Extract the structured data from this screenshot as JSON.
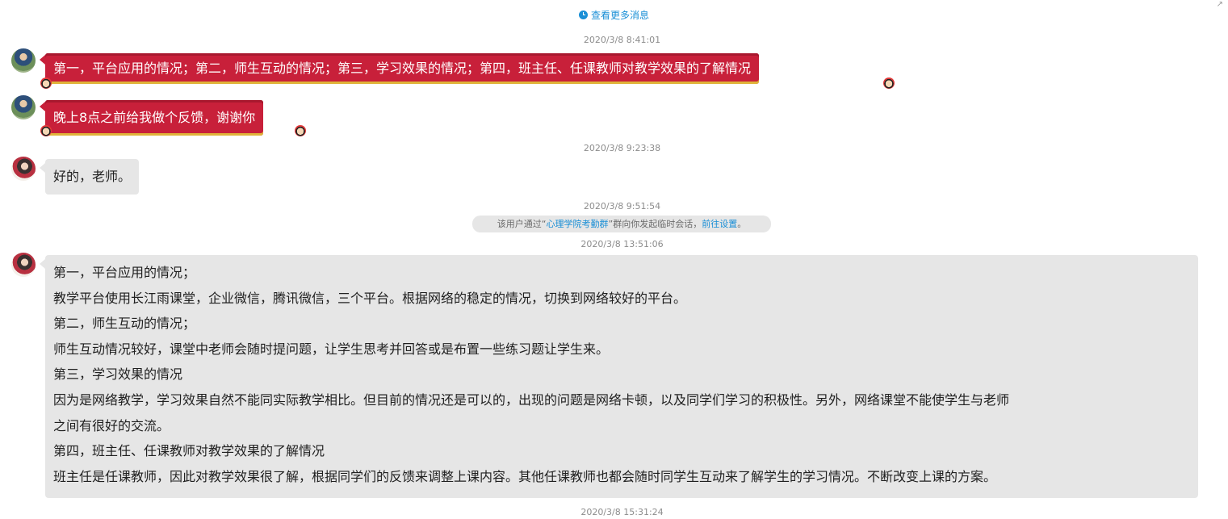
{
  "header": {
    "view_more_label": "查看更多消息"
  },
  "timestamps": {
    "t1": "2020/3/8 8:41:01",
    "t2": "2020/3/8 9:23:38",
    "t3": "2020/3/8 9:51:54",
    "t4": "2020/3/8 13:51:06",
    "t5": "2020/3/8 15:31:24"
  },
  "messages": {
    "m1": "第一，平台应用的情况；第二，师生互动的情况；第三，学习效果的情况；第四，班主任、任课教师对教学效果的了解情况",
    "m2": "晚上8点之前给我做个反馈，谢谢你",
    "m3": "好的，老师。",
    "m4_lines": [
      "第一，平台应用的情况；",
      "教学平台使用长江雨课堂，企业微信，腾讯微信，三个平台。根据网络的稳定的情况，切换到网络较好的平台。",
      "第二，师生互动的情况；",
      "师生互动情况较好，课堂中老师会随时提问题，让学生思考并回答或是布置一些练习题让学生来。",
      "第三，学习效果的情况",
      "因为是网络教学，学习效果自然不能同实际教学相比。但目前的情况还是可以的，出现的问题是网络卡顿，以及同学们学习的积极性。另外，网络课堂不能使学生与老师",
      "之间有很好的交流。",
      "第四，班主任、任课教师对教学效果的了解情况",
      "班主任是任课教师，因此对教学效果很了解，根据同学们的反馈来调整上课内容。其他任课教师也都会随时同学生互动来了解学生的学习情况。不断改变上课的方案。"
    ]
  },
  "system_notice": {
    "prefix": "该用户通过“",
    "group_name": "心理学院考勤群",
    "middle": "”群向你发起临时会话，",
    "link": "前往设置",
    "suffix": "。"
  },
  "colors": {
    "red_bubble": "#c8203a",
    "gray_bubble": "#e6e6e6",
    "link": "#1a8fd6"
  },
  "icons": {
    "clock": "clock-icon",
    "expand": "expand-corner-icon"
  }
}
